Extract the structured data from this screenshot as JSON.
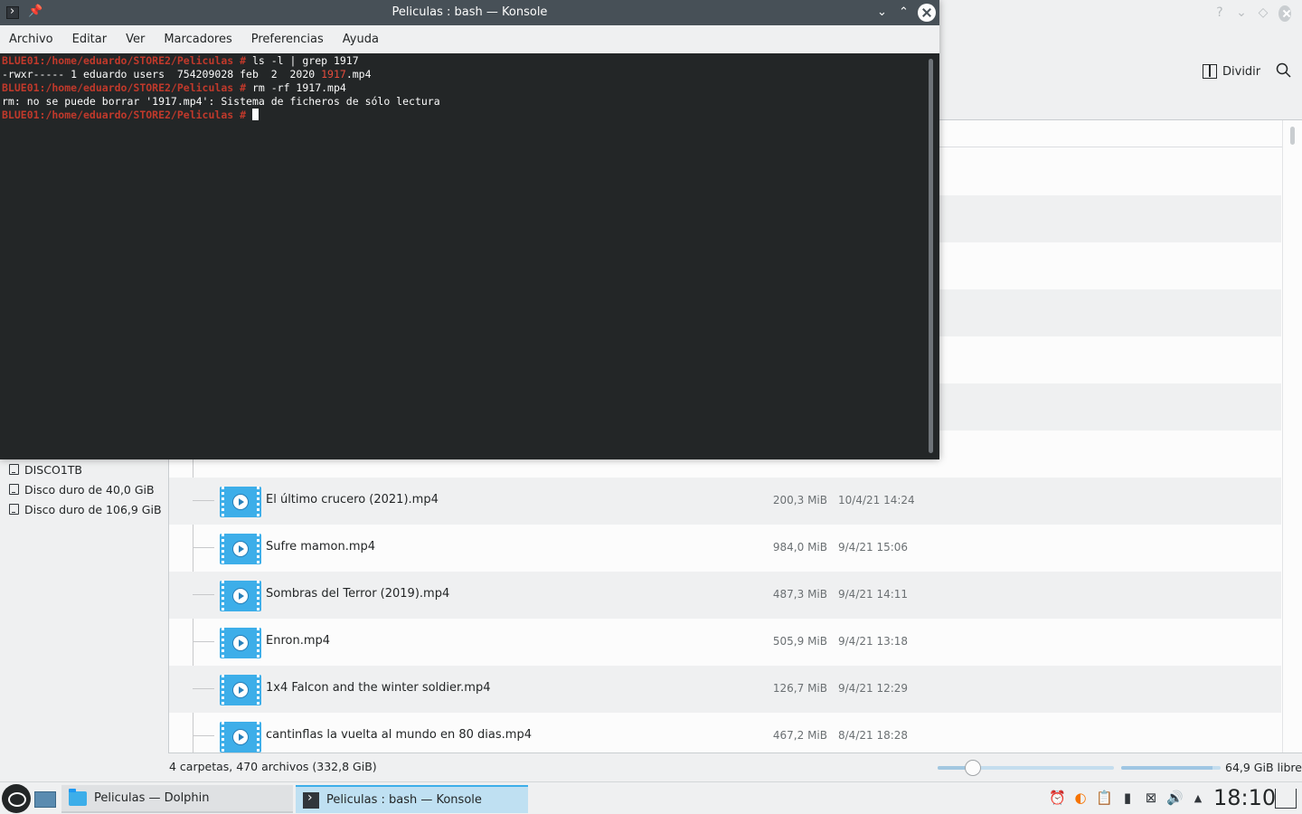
{
  "dolphin": {
    "window_buttons": {
      "help": "?",
      "minimize": "⌄",
      "maximize": "◇"
    },
    "split_label": "Dividir",
    "places": [
      {
        "label": "DISCO1TB"
      },
      {
        "label": "Disco duro de 40,0 GiB"
      },
      {
        "label": "Disco duro de 106,9 GiB"
      }
    ],
    "files": [
      {
        "name": "El último crucero (2021).mp4",
        "size": "200,3 MiB",
        "date": "10/4/21 14:24"
      },
      {
        "name": "Sufre mamon.mp4",
        "size": "984,0 MiB",
        "date": "9/4/21 15:06"
      },
      {
        "name": "Sombras del Terror (2019).mp4",
        "size": "487,3 MiB",
        "date": "9/4/21 14:11"
      },
      {
        "name": "Enron.mp4",
        "size": "505,9 MiB",
        "date": "9/4/21 13:18"
      },
      {
        "name": "1x4 Falcon and the winter soldier.mp4",
        "size": "126,7 MiB",
        "date": "9/4/21 12:29"
      },
      {
        "name": "cantinflas la vuelta al mundo en 80 dias.mp4",
        "size": "467,2 MiB",
        "date": "8/4/21 18:28"
      }
    ],
    "status": "4 carpetas, 470 archivos (332,8 GiB)",
    "zoom_level": 0.2,
    "disk_used_fraction": 0.92,
    "free_space": "64,9 GiB libre"
  },
  "konsole": {
    "title": "Peliculas : bash — Konsole",
    "menu": [
      "Archivo",
      "Editar",
      "Ver",
      "Marcadores",
      "Preferencias",
      "Ayuda"
    ],
    "terminal": {
      "line1_prompt": "BLUE01:/home/eduardo/STORE2/Peliculas #",
      "line1_cmd": " ls -l | grep 1917",
      "line2_pre": "-rwxr----- 1 eduardo users  754209028 feb  2  2020 ",
      "line2_match": "1917",
      "line2_post": ".mp4",
      "line3_prompt": "BLUE01:/home/eduardo/STORE2/Peliculas #",
      "line3_cmd": " rm -rf 1917.mp4",
      "line4": "rm: no se puede borrar '1917.mp4': Sistema de ficheros de sólo lectura",
      "line5_prompt": "BLUE01:/home/eduardo/STORE2/Peliculas #"
    }
  },
  "taskbar": {
    "tasks": [
      {
        "label": "Peliculas — Dolphin"
      },
      {
        "label": "Peliculas : bash — Konsole"
      }
    ],
    "clock": "18:10"
  },
  "colors": {
    "accent": "#3daee9",
    "prompt_red": "#c0392b",
    "terminal_bg": "#232627",
    "titlebar": "#475057"
  }
}
